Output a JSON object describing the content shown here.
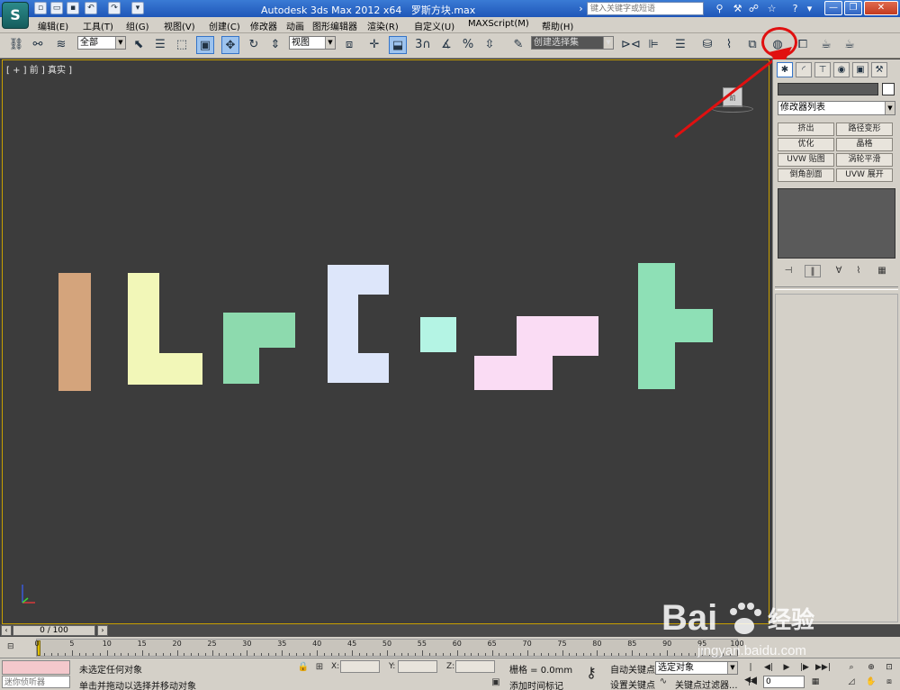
{
  "app": {
    "logo": "S",
    "title": "Autodesk 3ds Max  2012 x64",
    "title_filename": "罗斯方块.max",
    "help_search_placeholder": "键入关键字或短语"
  },
  "menu": [
    "编辑(E)",
    "工具(T)",
    "组(G)",
    "视图(V)",
    "创建(C)",
    "修改器",
    "动画",
    "图形编辑器",
    "渲染(R)",
    "自定义(U)",
    "MAXScript(M)",
    "帮助(H)"
  ],
  "toolbar": {
    "selection_filter": "全部",
    "reference_coord": "视图",
    "named_selection": "创建选择集",
    "snap_3": "3",
    "percent_snap": "%"
  },
  "viewport": {
    "label": "[ + ] 前 ] 真实 ]",
    "viewcube_label": "前",
    "shapes": [
      {
        "name": "i-piece",
        "color": "#d4a47c"
      },
      {
        "name": "l-piece",
        "color": "#f2f7b8"
      },
      {
        "name": "j-piece",
        "color": "#8ddaae"
      },
      {
        "name": "c-piece",
        "color": "#dde6fa"
      },
      {
        "name": "o-piece",
        "color": "#b4f4e4"
      },
      {
        "name": "z-piece",
        "color": "#fadcf4"
      },
      {
        "name": "t-piece",
        "color": "#8ee0b6"
      }
    ]
  },
  "command_panel": {
    "modifier_list": "修改器列表",
    "modifier_buttons": [
      "挤出",
      "路径变形",
      "优化",
      "晶格",
      "UVW 贴图",
      "涡轮平滑",
      "倒角剖面",
      "UVW 展开"
    ]
  },
  "timeline": {
    "slider": "0 / 100",
    "ticks": [
      "0",
      "5",
      "10",
      "15",
      "20",
      "25",
      "30",
      "35",
      "40",
      "45",
      "50",
      "55",
      "60",
      "65",
      "70",
      "75",
      "80",
      "85",
      "90",
      "95",
      "100"
    ]
  },
  "status": {
    "maxscript_placeholder": "迷你侦听器",
    "selection_status": "未选定任何对象",
    "prompt": "单击并拖动以选择并移动对象",
    "x_label": "X:",
    "y_label": "Y:",
    "z_label": "Z:",
    "grid": "栅格 = 0.0mm",
    "add_time_tag": "添加时间标记",
    "auto_key": "自动关键点",
    "set_key": "设置关键点",
    "key_mode": "选定对象",
    "key_filters": "关键点过滤器...",
    "frame": "0"
  },
  "watermark": {
    "brand": "Bai",
    "brand_tail": "经验",
    "url": "jingyan.baidu.com"
  }
}
